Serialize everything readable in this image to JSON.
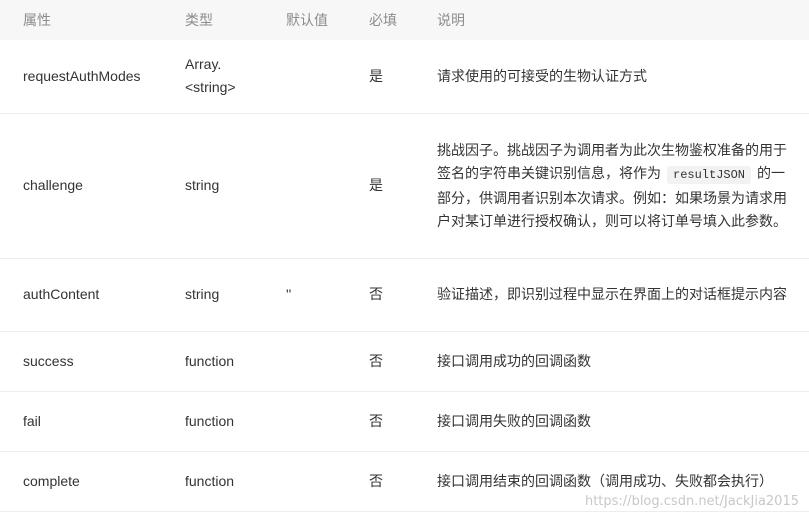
{
  "headers": {
    "property": "属性",
    "type": "类型",
    "default": "默认值",
    "required": "必填",
    "description": "说明"
  },
  "rows": [
    {
      "name": "requestAuthModes",
      "type_line1": "Array.",
      "type_line2": "<string>",
      "default": "",
      "required": "是",
      "desc_a": "请求使用的可接受的生物认证方式",
      "code": "",
      "desc_b": ""
    },
    {
      "name": "challenge",
      "type_line1": "string",
      "type_line2": "",
      "default": "",
      "required": "是",
      "desc_a": "挑战因子。挑战因子为调用者为此次生物鉴权准备的用于签名的字符串关键识别信息，将作为",
      "code": "resultJSON",
      "desc_b": "的一部分，供调用者识别本次请求。例如：如果场景为请求用户对某订单进行授权确认，则可以将订单号填入此参数。"
    },
    {
      "name": "authContent",
      "type_line1": "string",
      "type_line2": "",
      "default": "''",
      "required": "否",
      "desc_a": "验证描述，即识别过程中显示在界面上的对话框提示内容",
      "code": "",
      "desc_b": ""
    },
    {
      "name": "success",
      "type_line1": "function",
      "type_line2": "",
      "default": "",
      "required": "否",
      "desc_a": "接口调用成功的回调函数",
      "code": "",
      "desc_b": ""
    },
    {
      "name": "fail",
      "type_line1": "function",
      "type_line2": "",
      "default": "",
      "required": "否",
      "desc_a": "接口调用失败的回调函数",
      "code": "",
      "desc_b": ""
    },
    {
      "name": "complete",
      "type_line1": "function",
      "type_line2": "",
      "default": "",
      "required": "否",
      "desc_a": "接口调用结束的回调函数（调用成功、失败都会执行）",
      "code": "",
      "desc_b": ""
    }
  ],
  "watermark": "https://blog.csdn.net/JackJia2015"
}
